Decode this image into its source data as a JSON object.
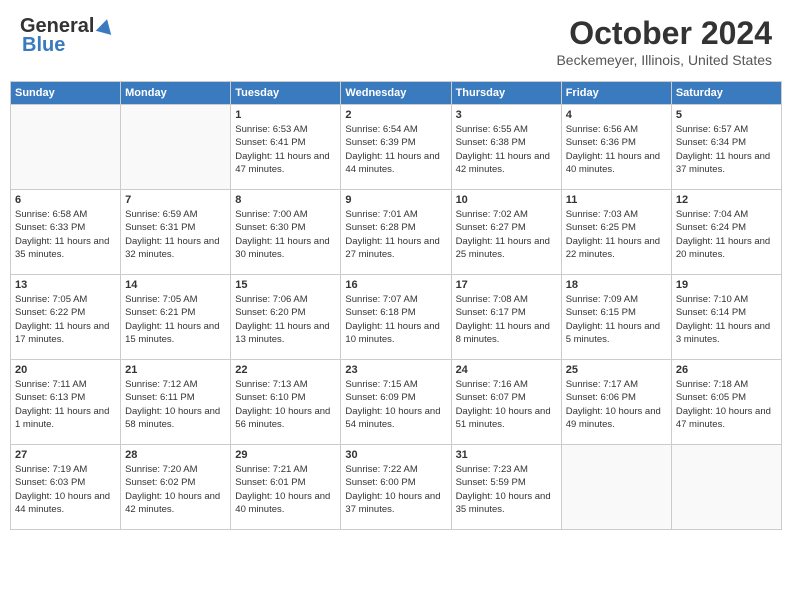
{
  "header": {
    "logo_general": "General",
    "logo_blue": "Blue",
    "month_title": "October 2024",
    "location": "Beckemeyer, Illinois, United States"
  },
  "days_of_week": [
    "Sunday",
    "Monday",
    "Tuesday",
    "Wednesday",
    "Thursday",
    "Friday",
    "Saturday"
  ],
  "weeks": [
    [
      {
        "day": "",
        "info": ""
      },
      {
        "day": "",
        "info": ""
      },
      {
        "day": "1",
        "sunrise": "6:53 AM",
        "sunset": "6:41 PM",
        "daylight": "11 hours and 47 minutes."
      },
      {
        "day": "2",
        "sunrise": "6:54 AM",
        "sunset": "6:39 PM",
        "daylight": "11 hours and 44 minutes."
      },
      {
        "day": "3",
        "sunrise": "6:55 AM",
        "sunset": "6:38 PM",
        "daylight": "11 hours and 42 minutes."
      },
      {
        "day": "4",
        "sunrise": "6:56 AM",
        "sunset": "6:36 PM",
        "daylight": "11 hours and 40 minutes."
      },
      {
        "day": "5",
        "sunrise": "6:57 AM",
        "sunset": "6:34 PM",
        "daylight": "11 hours and 37 minutes."
      }
    ],
    [
      {
        "day": "6",
        "sunrise": "6:58 AM",
        "sunset": "6:33 PM",
        "daylight": "11 hours and 35 minutes."
      },
      {
        "day": "7",
        "sunrise": "6:59 AM",
        "sunset": "6:31 PM",
        "daylight": "11 hours and 32 minutes."
      },
      {
        "day": "8",
        "sunrise": "7:00 AM",
        "sunset": "6:30 PM",
        "daylight": "11 hours and 30 minutes."
      },
      {
        "day": "9",
        "sunrise": "7:01 AM",
        "sunset": "6:28 PM",
        "daylight": "11 hours and 27 minutes."
      },
      {
        "day": "10",
        "sunrise": "7:02 AM",
        "sunset": "6:27 PM",
        "daylight": "11 hours and 25 minutes."
      },
      {
        "day": "11",
        "sunrise": "7:03 AM",
        "sunset": "6:25 PM",
        "daylight": "11 hours and 22 minutes."
      },
      {
        "day": "12",
        "sunrise": "7:04 AM",
        "sunset": "6:24 PM",
        "daylight": "11 hours and 20 minutes."
      }
    ],
    [
      {
        "day": "13",
        "sunrise": "7:05 AM",
        "sunset": "6:22 PM",
        "daylight": "11 hours and 17 minutes."
      },
      {
        "day": "14",
        "sunrise": "7:05 AM",
        "sunset": "6:21 PM",
        "daylight": "11 hours and 15 minutes."
      },
      {
        "day": "15",
        "sunrise": "7:06 AM",
        "sunset": "6:20 PM",
        "daylight": "11 hours and 13 minutes."
      },
      {
        "day": "16",
        "sunrise": "7:07 AM",
        "sunset": "6:18 PM",
        "daylight": "11 hours and 10 minutes."
      },
      {
        "day": "17",
        "sunrise": "7:08 AM",
        "sunset": "6:17 PM",
        "daylight": "11 hours and 8 minutes."
      },
      {
        "day": "18",
        "sunrise": "7:09 AM",
        "sunset": "6:15 PM",
        "daylight": "11 hours and 5 minutes."
      },
      {
        "day": "19",
        "sunrise": "7:10 AM",
        "sunset": "6:14 PM",
        "daylight": "11 hours and 3 minutes."
      }
    ],
    [
      {
        "day": "20",
        "sunrise": "7:11 AM",
        "sunset": "6:13 PM",
        "daylight": "11 hours and 1 minute."
      },
      {
        "day": "21",
        "sunrise": "7:12 AM",
        "sunset": "6:11 PM",
        "daylight": "10 hours and 58 minutes."
      },
      {
        "day": "22",
        "sunrise": "7:13 AM",
        "sunset": "6:10 PM",
        "daylight": "10 hours and 56 minutes."
      },
      {
        "day": "23",
        "sunrise": "7:15 AM",
        "sunset": "6:09 PM",
        "daylight": "10 hours and 54 minutes."
      },
      {
        "day": "24",
        "sunrise": "7:16 AM",
        "sunset": "6:07 PM",
        "daylight": "10 hours and 51 minutes."
      },
      {
        "day": "25",
        "sunrise": "7:17 AM",
        "sunset": "6:06 PM",
        "daylight": "10 hours and 49 minutes."
      },
      {
        "day": "26",
        "sunrise": "7:18 AM",
        "sunset": "6:05 PM",
        "daylight": "10 hours and 47 minutes."
      }
    ],
    [
      {
        "day": "27",
        "sunrise": "7:19 AM",
        "sunset": "6:03 PM",
        "daylight": "10 hours and 44 minutes."
      },
      {
        "day": "28",
        "sunrise": "7:20 AM",
        "sunset": "6:02 PM",
        "daylight": "10 hours and 42 minutes."
      },
      {
        "day": "29",
        "sunrise": "7:21 AM",
        "sunset": "6:01 PM",
        "daylight": "10 hours and 40 minutes."
      },
      {
        "day": "30",
        "sunrise": "7:22 AM",
        "sunset": "6:00 PM",
        "daylight": "10 hours and 37 minutes."
      },
      {
        "day": "31",
        "sunrise": "7:23 AM",
        "sunset": "5:59 PM",
        "daylight": "10 hours and 35 minutes."
      },
      {
        "day": "",
        "info": ""
      },
      {
        "day": "",
        "info": ""
      }
    ]
  ]
}
